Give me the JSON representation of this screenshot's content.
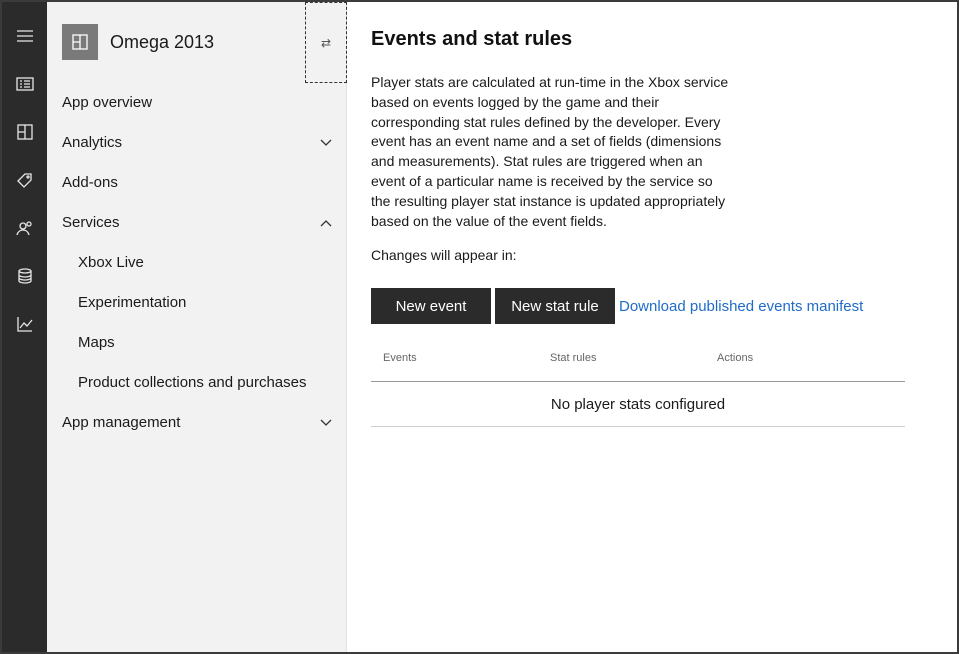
{
  "rail": {
    "icons": [
      "hamburger-icon",
      "dashboard-icon",
      "apps-icon",
      "tag-icon",
      "people-icon",
      "database-icon",
      "chart-icon"
    ]
  },
  "app": {
    "name": "Omega 2013",
    "switch_symbol": "⇄"
  },
  "nav": {
    "items": [
      {
        "label": "App overview",
        "expand": ""
      },
      {
        "label": "Analytics",
        "expand": "down"
      },
      {
        "label": "Add-ons",
        "expand": ""
      },
      {
        "label": "Services",
        "expand": "up"
      },
      {
        "label": "Xbox Live",
        "sub": true
      },
      {
        "label": "Experimentation",
        "sub": true
      },
      {
        "label": "Maps",
        "sub": true
      },
      {
        "label": "Product collections and purchases",
        "sub": true
      },
      {
        "label": "App management",
        "expand": "down"
      }
    ]
  },
  "main": {
    "title": "Events and stat rules",
    "description": "Player stats are calculated at run-time in the Xbox service based on events logged by the game and their corresponding stat rules defined by the developer. Every event has an event name and a set of fields (dimensions and measurements). Stat rules are triggered when an event of a particular name is received by the service so the resulting player stat instance is updated appropriately based on the value of the event fields.",
    "changes_label": "Changes will appear in:",
    "new_event_label": "New event",
    "new_stat_rule_label": "New stat rule",
    "download_link": "Download published events manifest",
    "table": {
      "columns": [
        "Events",
        "Stat rules",
        "Actions"
      ],
      "empty_message": "No player stats configured"
    }
  },
  "colors": {
    "rail_bg": "#2b2b2b",
    "nav_bg": "#f2f2f2",
    "button_bg": "#2b2b2b",
    "link": "#1f6cc9"
  }
}
